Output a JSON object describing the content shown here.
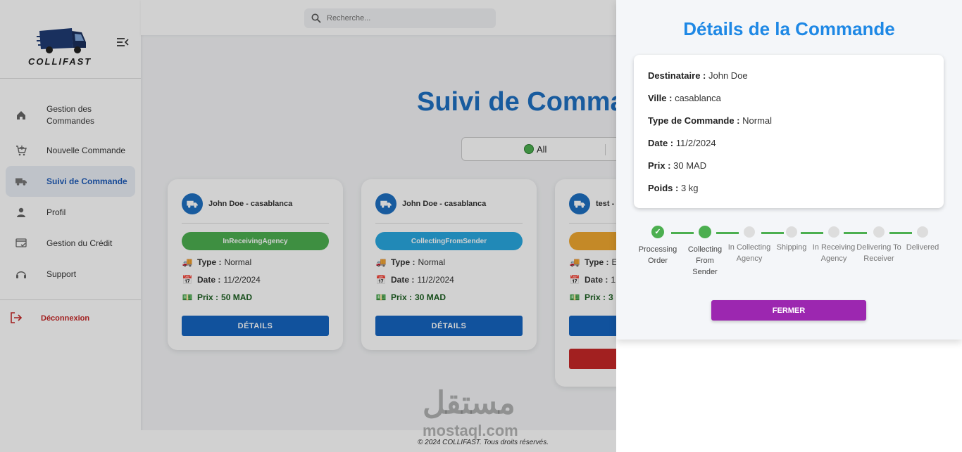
{
  "brand": {
    "name": "COLLIFAST"
  },
  "search": {
    "placeholder": "Recherche..."
  },
  "sidebar": {
    "items": [
      {
        "label": "Gestion des Commandes",
        "icon": "home-icon"
      },
      {
        "label": "Nouvelle Commande",
        "icon": "cart-add-icon"
      },
      {
        "label": "Suivi de Commande",
        "icon": "truck-icon"
      },
      {
        "label": "Profil",
        "icon": "person-icon"
      },
      {
        "label": "Gestion du Crédit",
        "icon": "credit-card-icon"
      },
      {
        "label": "Support",
        "icon": "support-icon"
      }
    ],
    "logout": "Déconnexion"
  },
  "main": {
    "title": "Suivi de Commande",
    "filter": {
      "value": "All"
    },
    "cards": [
      {
        "name": "John Doe - casablanca",
        "status": "InReceivingAgency",
        "status_color": "#4caf50",
        "type_label": "Type :",
        "type": "Normal",
        "date_label": "Date :",
        "date": "11/2/2024",
        "price_label": "Prix :",
        "price": "50 MAD",
        "button": "DÉTAILS"
      },
      {
        "name": "John Doe - casablanca",
        "status": "CollectingFromSender",
        "status_color": "#29a8e0",
        "type_label": "Type :",
        "type": "Normal",
        "date_label": "Date :",
        "date": "11/2/2024",
        "price_label": "Prix :",
        "price": "30 MAD",
        "button": "DÉTAILS"
      },
      {
        "name": "test -",
        "status": "",
        "status_color": "#f0a830",
        "type_label": "Type :",
        "type": "E",
        "date_label": "Date :",
        "date": "1",
        "price_label": "Prix :",
        "price": "3",
        "button": ""
      }
    ]
  },
  "footer": {
    "text": "© 2024 COLLIFAST. Tous droits réservés."
  },
  "watermark": {
    "arabic": "مستقل",
    "latin": "mostaql.com"
  },
  "modal": {
    "title": "Détails de la Commande",
    "fields": [
      {
        "label": "Destinataire :",
        "value": "John Doe"
      },
      {
        "label": "Ville :",
        "value": "casablanca"
      },
      {
        "label": "Type de Commande :",
        "value": "Normal"
      },
      {
        "label": "Date :",
        "value": "11/2/2024"
      },
      {
        "label": "Prix :",
        "value": "30 MAD"
      },
      {
        "label": "Poids :",
        "value": "3 kg"
      }
    ],
    "steps": [
      {
        "label": "Processing Order",
        "state": "done"
      },
      {
        "label": "Collecting From Sender",
        "state": "current"
      },
      {
        "label": "In Collecting Agency",
        "state": "pending"
      },
      {
        "label": "Shipping",
        "state": "pending"
      },
      {
        "label": "In Receiving Agency",
        "state": "pending"
      },
      {
        "label": "Delivering To Receiver",
        "state": "pending"
      },
      {
        "label": "Delivered",
        "state": "pending"
      }
    ],
    "close_button": "FERMER"
  }
}
